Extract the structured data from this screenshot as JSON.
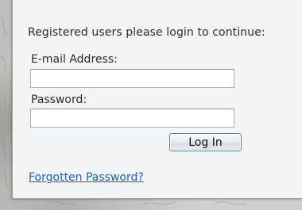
{
  "login_form": {
    "intro_text": "Registered users please login to continue:",
    "email_label": "E-mail Address:",
    "email_value": "",
    "password_label": "Password:",
    "password_value": "",
    "login_button_label": "Log In",
    "forgot_password_link": "Forgotten Password?"
  },
  "colors": {
    "panel_background": "#f3f4f5",
    "link_color": "#1f5fa8",
    "page_background": "#c8c8c6"
  }
}
